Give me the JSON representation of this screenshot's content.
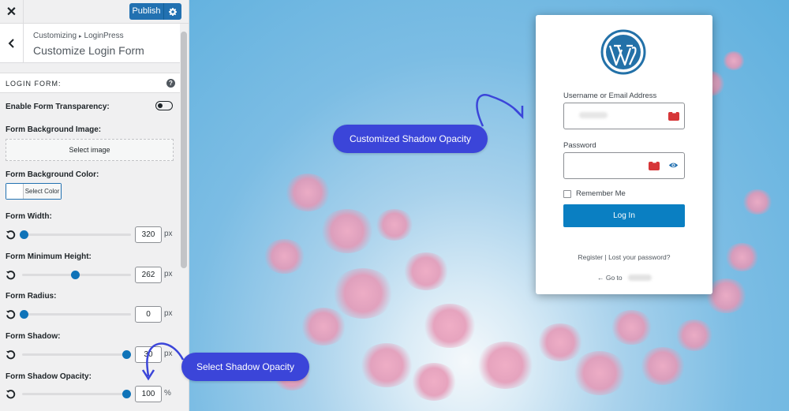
{
  "topbar": {
    "close_glyph": "✕",
    "publish_label": "Publish"
  },
  "header": {
    "breadcrumb_parent": "Customizing",
    "breadcrumb_child": "LoginPress",
    "title": "Customize Login Form"
  },
  "section": {
    "title": "LOGIN FORM:",
    "help_glyph": "?"
  },
  "controls": {
    "transparency_label": "Enable Form Transparency:",
    "bg_image_label": "Form Background Image:",
    "select_image": "Select image",
    "bg_color_label": "Form Background Color:",
    "select_color": "Select Color",
    "sliders": [
      {
        "label": "Form Width:",
        "value": "320",
        "unit": "px",
        "fraction": 0.0
      },
      {
        "label": "Form Minimum Height:",
        "value": "262",
        "unit": "px",
        "fraction": 0.5
      },
      {
        "label": "Form Radius:",
        "value": "0",
        "unit": "px",
        "fraction": 0.0
      },
      {
        "label": "Form Shadow:",
        "value": "30",
        "unit": "px",
        "fraction": 1.0
      },
      {
        "label": "Form Shadow Opacity:",
        "value": "100",
        "unit": "%",
        "fraction": 1.0
      }
    ]
  },
  "login": {
    "username_label": "Username or Email Address",
    "password_label": "Password",
    "remember_label": "Remember Me",
    "login_button": "Log In",
    "links": "Register | Lost your password?",
    "goto": "← Go to"
  },
  "callouts": {
    "customized": "Customized Shadow Opacity",
    "select": "Select Shadow Opacity"
  },
  "colors": {
    "accent": "#2271b1",
    "callout": "#3b45d9",
    "login_button": "#0a7fc2"
  }
}
